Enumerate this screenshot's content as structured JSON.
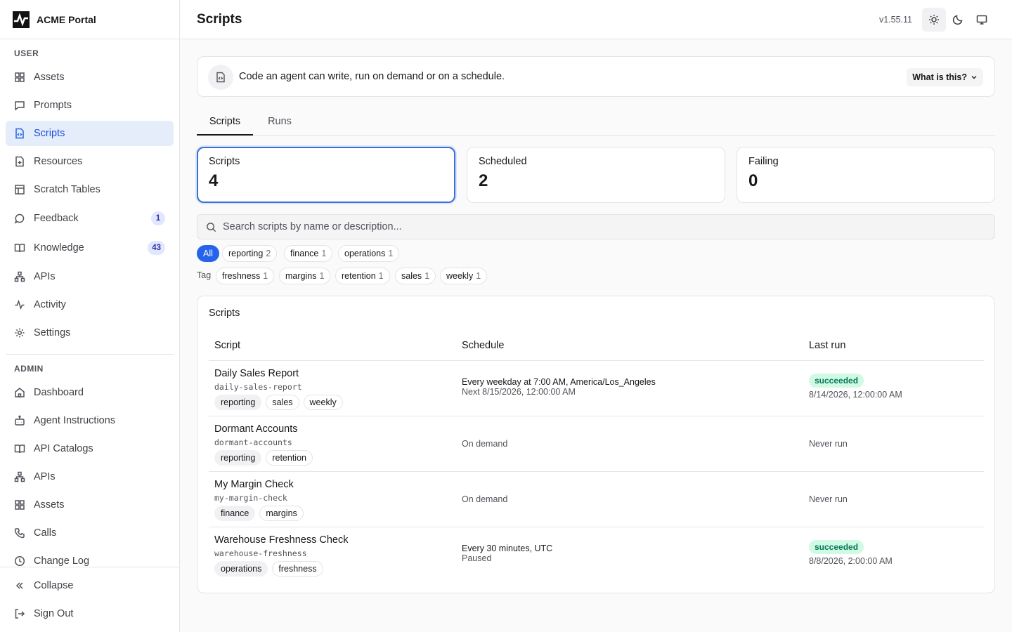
{
  "app": {
    "brand": "ACME Portal",
    "version": "v1.55.11"
  },
  "sidebar": {
    "user_label": "USER",
    "admin_label": "ADMIN",
    "user_items": [
      {
        "label": "Assets",
        "icon": "grid-icon"
      },
      {
        "label": "Prompts",
        "icon": "message-square-icon"
      },
      {
        "label": "Scripts",
        "icon": "file-code-icon",
        "active": true
      },
      {
        "label": "Resources",
        "icon": "file-plus-icon"
      },
      {
        "label": "Scratch Tables",
        "icon": "table-icon"
      },
      {
        "label": "Feedback",
        "icon": "message-circle-icon",
        "badge": "1"
      },
      {
        "label": "Knowledge",
        "icon": "book-open-icon",
        "badge": "43"
      },
      {
        "label": "APIs",
        "icon": "network-icon"
      },
      {
        "label": "Activity",
        "icon": "activity-icon"
      },
      {
        "label": "Settings",
        "icon": "gear-icon"
      }
    ],
    "admin_items": [
      {
        "label": "Dashboard",
        "icon": "home-icon"
      },
      {
        "label": "Agent Instructions",
        "icon": "bot-icon"
      },
      {
        "label": "API Catalogs",
        "icon": "book-open-icon"
      },
      {
        "label": "APIs",
        "icon": "network-icon"
      },
      {
        "label": "Assets",
        "icon": "grid-icon"
      },
      {
        "label": "Calls",
        "icon": "phone-icon"
      },
      {
        "label": "Change Log",
        "icon": "clock-icon"
      }
    ],
    "collapse_label": "Collapse",
    "signout_label": "Sign Out"
  },
  "header": {
    "title": "Scripts"
  },
  "info": {
    "text": "Code an agent can write, run on demand or on a schedule.",
    "button": "What is this?"
  },
  "tabs": [
    "Scripts",
    "Runs"
  ],
  "stats": [
    {
      "label": "Scripts",
      "value": "4"
    },
    {
      "label": "Scheduled",
      "value": "2"
    },
    {
      "label": "Failing",
      "value": "0"
    }
  ],
  "search": {
    "placeholder": "Search scripts by name or description..."
  },
  "category_filters": [
    {
      "label": "All",
      "count": ""
    },
    {
      "label": "reporting",
      "count": "2"
    },
    {
      "label": "finance",
      "count": "1"
    },
    {
      "label": "operations",
      "count": "1"
    }
  ],
  "tag_label": "Tag",
  "tag_filters": [
    {
      "label": "freshness",
      "count": "1"
    },
    {
      "label": "margins",
      "count": "1"
    },
    {
      "label": "retention",
      "count": "1"
    },
    {
      "label": "sales",
      "count": "1"
    },
    {
      "label": "weekly",
      "count": "1"
    }
  ],
  "table": {
    "title": "Scripts",
    "columns": [
      "Script",
      "Schedule",
      "Last run"
    ],
    "rows": [
      {
        "name": "Daily Sales Report",
        "slug": "daily-sales-report",
        "tags": [
          "reporting",
          "sales",
          "weekly"
        ],
        "schedule": "Every weekday at 7:00 AM, America/Los_Angeles",
        "schedule_sub": "Next 8/15/2026, 12:00:00 AM",
        "status": "succeeded",
        "last_run": "8/14/2026, 12:00:00 AM"
      },
      {
        "name": "Dormant Accounts",
        "slug": "dormant-accounts",
        "tags": [
          "reporting",
          "retention"
        ],
        "schedule": "On demand",
        "schedule_sub": "",
        "status": "",
        "last_run": "Never run"
      },
      {
        "name": "My Margin Check",
        "slug": "my-margin-check",
        "tags": [
          "finance",
          "margins"
        ],
        "schedule": "On demand",
        "schedule_sub": "",
        "status": "",
        "last_run": "Never run"
      },
      {
        "name": "Warehouse Freshness Check",
        "slug": "warehouse-freshness",
        "tags": [
          "operations",
          "freshness"
        ],
        "schedule": "Every 30 minutes, UTC",
        "schedule_sub": "Paused",
        "status": "succeeded",
        "last_run": "8/8/2026, 2:00:00 AM"
      }
    ]
  },
  "colors": {
    "accent": "#2563eb",
    "active_bg": "#e5edfb",
    "success_bg": "#d1fae5",
    "success_text": "#047857"
  }
}
